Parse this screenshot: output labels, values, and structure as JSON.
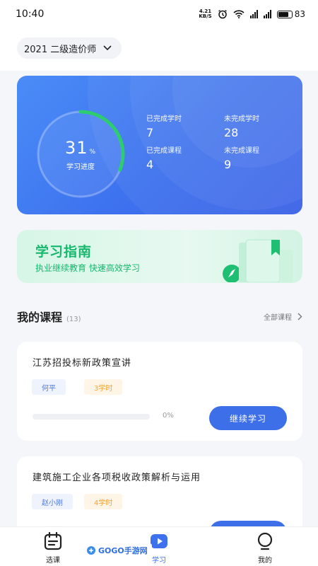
{
  "status_bar": {
    "time": "10:40",
    "net_speed_top": "4.21",
    "net_speed_bottom": "KB/S",
    "battery": "83",
    "signal_1": "4G",
    "signal_2": "4G"
  },
  "header": {
    "exam_selector": "2021 二级造价师"
  },
  "progress_card": {
    "percent": "31",
    "percent_sign": "%",
    "percent_value": 31,
    "label": "学习进度",
    "stats": [
      {
        "label": "已完成学时",
        "value": "7"
      },
      {
        "label": "未完成学时",
        "value": "28"
      },
      {
        "label": "已完成课程",
        "value": "4"
      },
      {
        "label": "未完成课程",
        "value": "9"
      }
    ]
  },
  "guide_banner": {
    "title": "学习指南",
    "subtitle": "执业继续教育  快速高效学习"
  },
  "my_courses": {
    "title": "我的课程",
    "count": "(13)",
    "all_link": "全部课程",
    "courses": [
      {
        "title": "江苏招投标新政策宣讲",
        "teacher": "何平",
        "hours": "3学时",
        "progress": "0%",
        "progress_value": 0,
        "button": "继续学习"
      },
      {
        "title": "建筑施工企业各项税收政策解析与运用",
        "teacher": "赵小刚",
        "hours": "4学时",
        "progress": "",
        "progress_value": 0,
        "button": ""
      }
    ]
  },
  "tabbar": {
    "tabs": [
      {
        "label": "选课",
        "icon": "calendar-icon"
      },
      {
        "label": "学习",
        "icon": "play-icon"
      },
      {
        "label": "我的",
        "icon": "user-icon"
      }
    ],
    "active": "学习"
  },
  "watermark": {
    "brand": "GOGO手游网"
  },
  "colors": {
    "primary": "#3d71ee",
    "green": "#17b86d",
    "orange": "#f2a43a"
  }
}
